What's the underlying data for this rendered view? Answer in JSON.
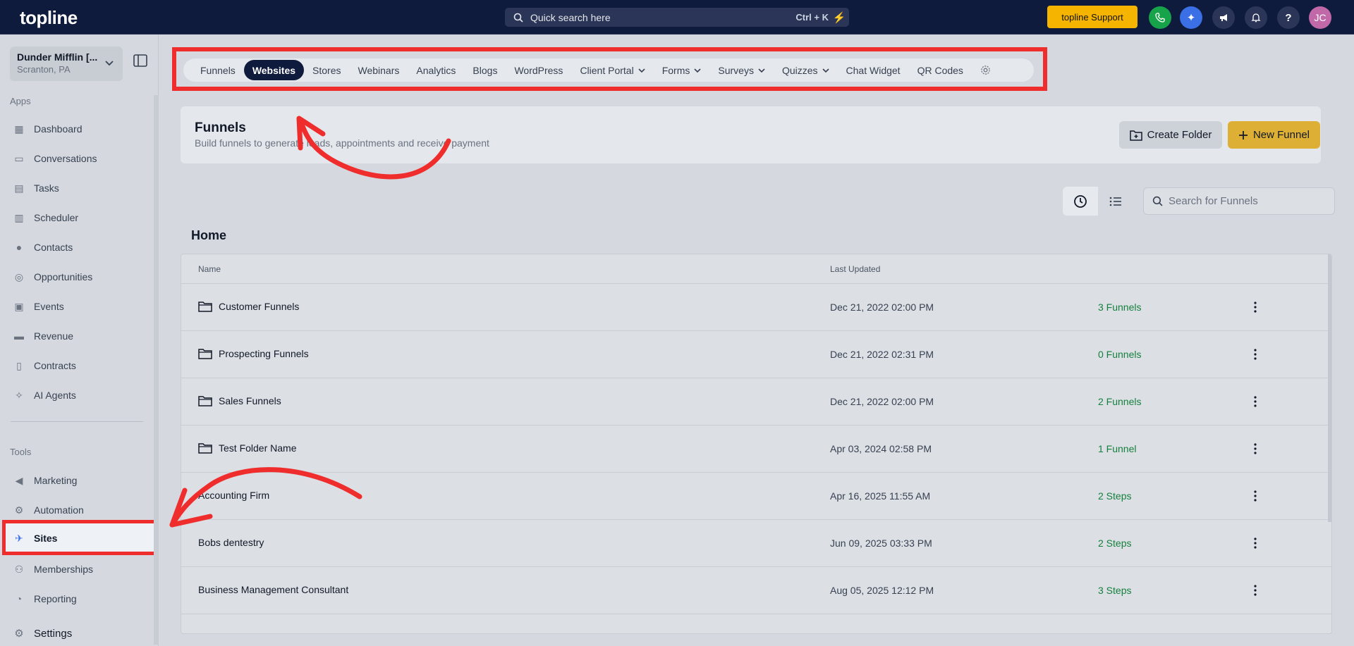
{
  "app": {
    "logo": "topline",
    "search_label": "Quick search here",
    "search_shortcut": "Ctrl + K",
    "support_label": "topline Support",
    "avatar_initials": "JC"
  },
  "account": {
    "name": "Dunder Mifflin [...",
    "location": "Scranton, PA"
  },
  "sidebar": {
    "apps_label": "Apps",
    "tools_label": "Tools",
    "apps": [
      {
        "label": "Dashboard",
        "icon": "dashboard-icon"
      },
      {
        "label": "Conversations",
        "icon": "chat-icon"
      },
      {
        "label": "Tasks",
        "icon": "tasks-icon"
      },
      {
        "label": "Scheduler",
        "icon": "calendar-icon"
      },
      {
        "label": "Contacts",
        "icon": "user-icon"
      },
      {
        "label": "Opportunities",
        "icon": "target-icon"
      },
      {
        "label": "Events",
        "icon": "events-icon"
      },
      {
        "label": "Revenue",
        "icon": "card-icon"
      },
      {
        "label": "Contracts",
        "icon": "document-icon"
      },
      {
        "label": "AI Agents",
        "icon": "sparkle-icon"
      }
    ],
    "tools": [
      {
        "label": "Marketing",
        "icon": "megaphone-icon"
      },
      {
        "label": "Automation",
        "icon": "gears-icon"
      },
      {
        "label": "Sites",
        "icon": "sites-icon"
      },
      {
        "label": "Memberships",
        "icon": "members-icon"
      },
      {
        "label": "Reporting",
        "icon": "pie-icon"
      }
    ],
    "settings_label": "Settings"
  },
  "tabs": [
    {
      "label": "Funnels"
    },
    {
      "label": "Websites",
      "active": true
    },
    {
      "label": "Stores"
    },
    {
      "label": "Webinars"
    },
    {
      "label": "Analytics"
    },
    {
      "label": "Blogs"
    },
    {
      "label": "WordPress"
    },
    {
      "label": "Client Portal",
      "dropdown": true
    },
    {
      "label": "Forms",
      "dropdown": true
    },
    {
      "label": "Surveys",
      "dropdown": true
    },
    {
      "label": "Quizzes",
      "dropdown": true
    },
    {
      "label": "Chat Widget"
    },
    {
      "label": "QR Codes"
    }
  ],
  "header": {
    "title": "Funnels",
    "subtitle": "Build funnels to generate leads, appointments and receive payment",
    "create_folder": "Create Folder",
    "new_funnel": "New Funnel"
  },
  "filter": {
    "placeholder": "Search for Funnels"
  },
  "section_title": "Home",
  "table": {
    "col_name": "Name",
    "col_updated": "Last Updated",
    "rows": [
      {
        "name": "Customer Funnels",
        "folder": true,
        "updated": "Dec 21, 2022 02:00 PM",
        "count": "3 Funnels"
      },
      {
        "name": "Prospecting Funnels",
        "folder": true,
        "updated": "Dec 21, 2022 02:31 PM",
        "count": "0 Funnels"
      },
      {
        "name": "Sales Funnels",
        "folder": true,
        "updated": "Dec 21, 2022 02:00 PM",
        "count": "2 Funnels"
      },
      {
        "name": "Test Folder Name",
        "folder": true,
        "updated": "Apr 03, 2024 02:58 PM",
        "count": "1 Funnel"
      },
      {
        "name": "Accounting Firm",
        "folder": false,
        "updated": "Apr 16, 2025 11:55 AM",
        "count": "2 Steps"
      },
      {
        "name": "Bobs dentestry",
        "folder": false,
        "updated": "Jun 09, 2025 03:33 PM",
        "count": "2 Steps"
      },
      {
        "name": "Business Management Consultant",
        "folder": false,
        "updated": "Aug 05, 2025 12:12 PM",
        "count": "3 Steps"
      }
    ]
  },
  "colors": {
    "navy": "#0f1b3d",
    "accent_yellow": "#f4b400",
    "annotation_red": "#ef2d2d",
    "count_green": "#15803d"
  }
}
